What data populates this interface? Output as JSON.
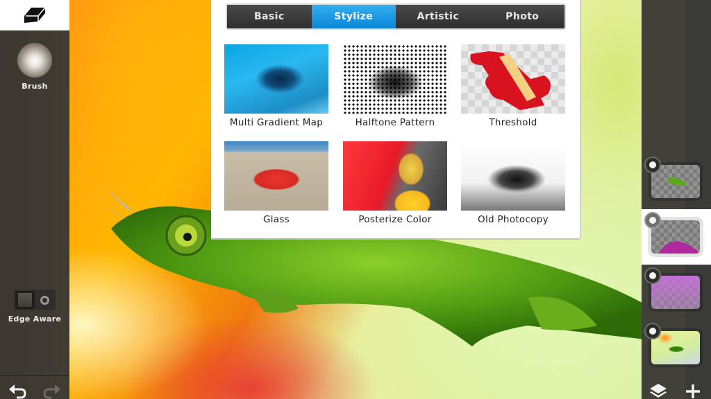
{
  "app": {
    "accent_color": "#1a9ae6"
  },
  "left_toolbar": {
    "top_tool_icon": "eraser-icon",
    "brush_label": "Brush",
    "edge_aware_label": "Edge Aware",
    "edge_aware_state": "off",
    "undo_icon": "undo-icon",
    "redo_icon": "redo-icon",
    "redo_enabled": false
  },
  "filter_panel": {
    "tabs": [
      {
        "label": "Basic",
        "active": false
      },
      {
        "label": "Stylize",
        "active": true
      },
      {
        "label": "Artistic",
        "active": false
      },
      {
        "label": "Photo",
        "active": false
      }
    ],
    "filters": [
      {
        "label": "Multi Gradient Map"
      },
      {
        "label": "Halftone Pattern"
      },
      {
        "label": "Threshold"
      },
      {
        "label": "Glass"
      },
      {
        "label": "Posterize Color"
      },
      {
        "label": "Old Photocopy"
      }
    ]
  },
  "layers_panel": {
    "layers": [
      {
        "content": "chameleon cutout",
        "visible": true,
        "selected": false
      },
      {
        "content": "magenta gradient bottom",
        "visible": true,
        "selected": true
      },
      {
        "content": "purple gradient",
        "visible": true,
        "selected": false
      },
      {
        "content": "chameleon on flower photo",
        "visible": true,
        "selected": false
      }
    ],
    "layers_icon": "layers-icon",
    "add_icon": "plus-icon"
  }
}
